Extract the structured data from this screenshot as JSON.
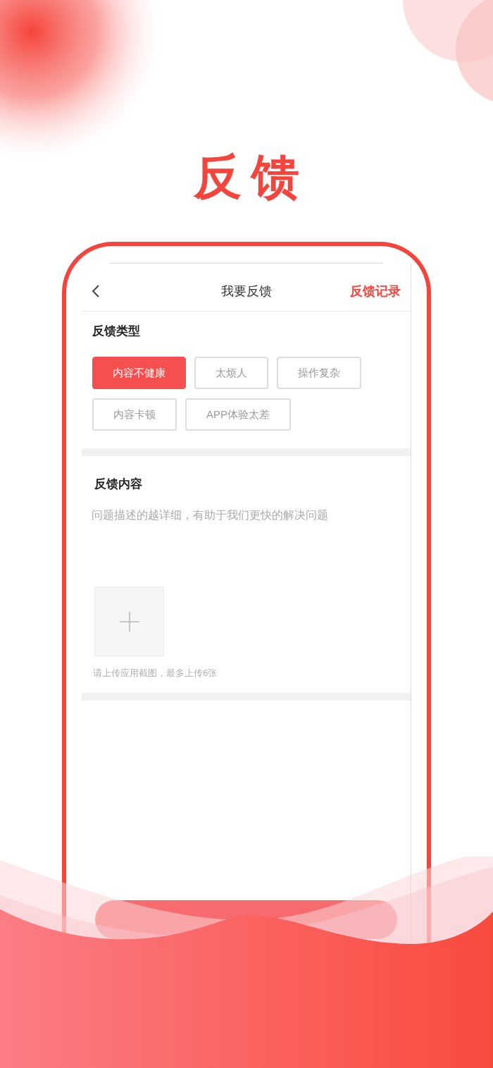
{
  "hero_title": "反馈",
  "nav": {
    "title": "我要反馈",
    "action": "反馈记录"
  },
  "feedback_type": {
    "heading": "反馈类型",
    "options": [
      {
        "label": "内容不健康",
        "selected": true
      },
      {
        "label": "太烦人",
        "selected": false
      },
      {
        "label": "操作复杂",
        "selected": false
      },
      {
        "label": "内容卡顿",
        "selected": false
      },
      {
        "label": "APP体验太差",
        "selected": false
      }
    ]
  },
  "feedback_content": {
    "heading": "反馈内容",
    "placeholder": "问题描述的越详细，有助于我们更快的解决问题",
    "upload_hint": "请上传应用截图，最多上传6张"
  }
}
